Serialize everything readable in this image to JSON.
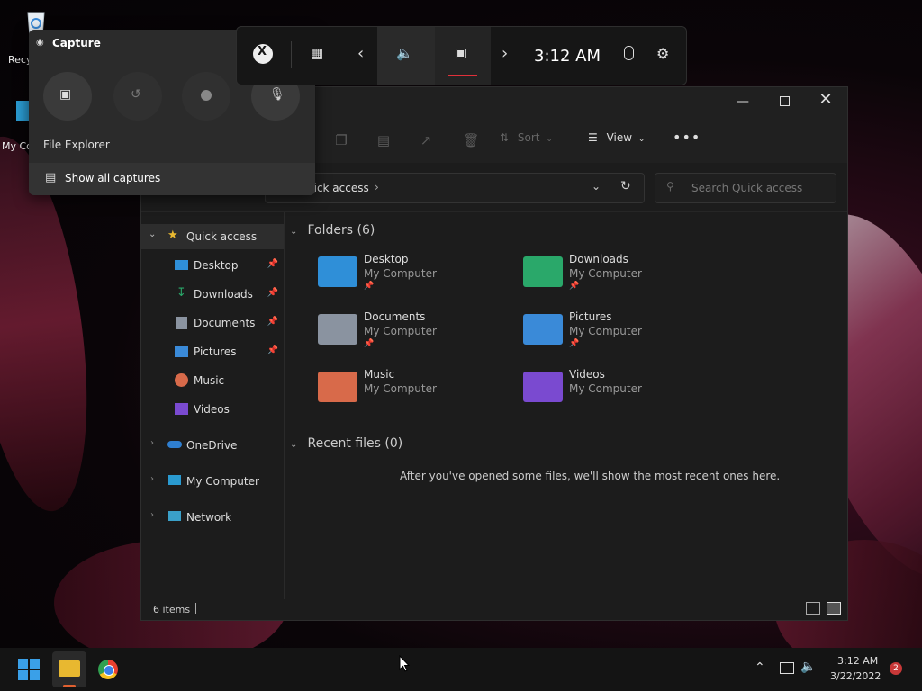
{
  "desktop": {
    "recycle_bin_label": "Recy",
    "my_computer_label": "My Co"
  },
  "capture": {
    "title": "Capture",
    "app_name": "File Explorer",
    "show_all_captures": "Show all captures"
  },
  "gamebar": {
    "time": "3:12 AM"
  },
  "explorer": {
    "toolbar": {
      "sort_label": "Sort",
      "view_label": "View"
    },
    "address_text": "uick access",
    "search_placeholder": "Search Quick access",
    "nav": {
      "quick_access": "Quick access",
      "desktop": "Desktop",
      "downloads": "Downloads",
      "documents": "Documents",
      "pictures": "Pictures",
      "music": "Music",
      "videos": "Videos",
      "onedrive": "OneDrive",
      "my_computer": "My Computer",
      "network": "Network"
    },
    "folders_header": "Folders (6)",
    "folders": [
      {
        "name": "Desktop",
        "location": "My Computer",
        "pinned": true,
        "color": "#2f8fd8"
      },
      {
        "name": "Downloads",
        "location": "My Computer",
        "pinned": true,
        "color": "#2aa86a"
      },
      {
        "name": "Documents",
        "location": "My Computer",
        "pinned": true,
        "color": "#8a93a0"
      },
      {
        "name": "Pictures",
        "location": "My Computer",
        "pinned": true,
        "color": "#3a8ad8"
      },
      {
        "name": "Music",
        "location": "My Computer",
        "pinned": false,
        "color": "#d86a4a"
      },
      {
        "name": "Videos",
        "location": "My Computer",
        "pinned": false,
        "color": "#7a4ad0"
      }
    ],
    "recent_header": "Recent files (0)",
    "recent_empty": "After you've opened some files, we'll show the most recent ones here.",
    "status_items": "6 items"
  },
  "taskbar": {
    "time": "3:12 AM",
    "date": "3/22/2022",
    "notification_count": "2"
  }
}
